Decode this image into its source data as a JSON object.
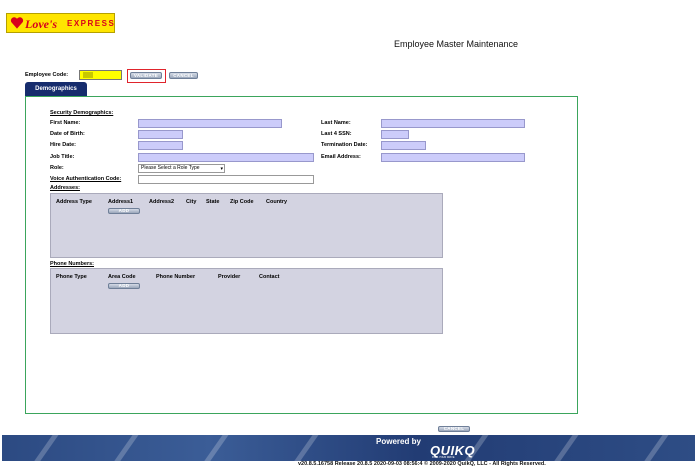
{
  "header": {
    "logo_brand": "Love's",
    "logo_suffix": "EXPRESS",
    "page_title": "Employee Master Maintenance"
  },
  "toolbar": {
    "employee_code_label": "Employee Code:",
    "employee_code_value": "",
    "validate_label": "VALIDATE",
    "cancel_label": "CANCEL"
  },
  "tabs": [
    {
      "label": "Demographics",
      "active": true
    }
  ],
  "form": {
    "section_title": "Security Demographics:",
    "first_name_label": "First Name:",
    "last_name_label": "Last Name:",
    "dob_label": "Date of Birth:",
    "last4_label": "Last 4 SSN:",
    "hire_date_label": "Hire Date:",
    "termination_label": "Termination Date:",
    "job_title_label": "Job Title:",
    "email_label": "Email Address:",
    "role_label": "Role:",
    "role_selected": "Please Select a Role Type",
    "voice_label": "Voice Authentication Code:"
  },
  "addresses": {
    "title": "Addresses:",
    "columns": [
      "Address Type",
      "Address1",
      "Address2",
      "City",
      "State",
      "Zip Code",
      "Country"
    ],
    "add_label": "ADD"
  },
  "phones": {
    "title": "Phone Numbers:",
    "columns": [
      "Phone Type",
      "Area Code",
      "Phone Number",
      "Provider",
      "Contact"
    ],
    "add_label": "ADD"
  },
  "footer": {
    "cancel_label": "CANCEL",
    "powered_by": "Powered by",
    "brand": "QUIKQ",
    "tagline": "FUEL YOUR DRIVE",
    "version": "v20.8.5.16758  Release  20.8.5  2020-09-03  08:56:4 © 2009-2020 QuikQ, LLC - All Rights Reserved."
  },
  "colors": {
    "logo_bg": "#ffe500",
    "brand_red": "#d8001c",
    "tab_bg": "#162c6d",
    "field_bg": "#ccccfa",
    "panel_border": "#3ba55c",
    "employee_code_bg": "#ffff00",
    "validate_highlight": "#e0242c",
    "footer_bg": "#2c4a82"
  }
}
